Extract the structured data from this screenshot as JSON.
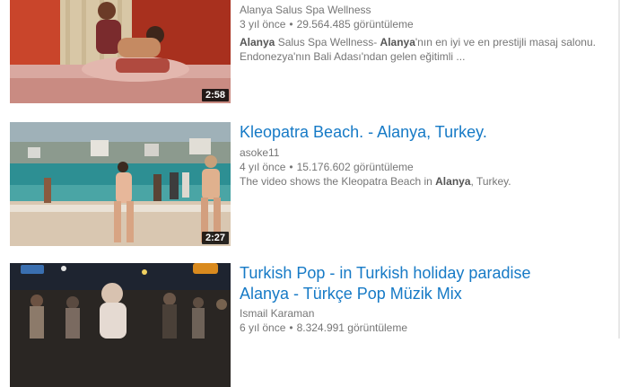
{
  "results": [
    {
      "duration": "2:58",
      "channel": "Alanya Salus Spa Wellness",
      "age": "3 yıl önce",
      "views": "29.564.485 görüntüleme",
      "desc": {
        "b1": "Alanya",
        "t1": " Salus Spa Wellness- ",
        "b2": "Alanya",
        "t2": "'nın en iyi ve en prestijli masaj salonu.",
        "line2": "Endonezya'nın Bali Adası'ndan gelen eğitimli ..."
      }
    },
    {
      "title": "Kleopatra Beach. - Alanya, Turkey.",
      "duration": "2:27",
      "channel": "asoke11",
      "age": "4 yıl önce",
      "views": "15.176.602 görüntüleme",
      "desc": {
        "t1": "The video shows the Kleopatra Beach in ",
        "b1": "Alanya",
        "t2": ", Turkey."
      }
    },
    {
      "title_line1": "Turkish Pop - in Turkish holiday paradise",
      "title_line2": "Alanya - Türkçe Pop Müzik Mix",
      "channel": "Ismail Karaman",
      "age": "6 yıl önce",
      "views": "8.324.991 görüntüleme"
    }
  ],
  "separator": "•",
  "colors": {
    "title_link": "#167ac6",
    "meta_text": "#767676",
    "duration_bg": "#000000"
  }
}
